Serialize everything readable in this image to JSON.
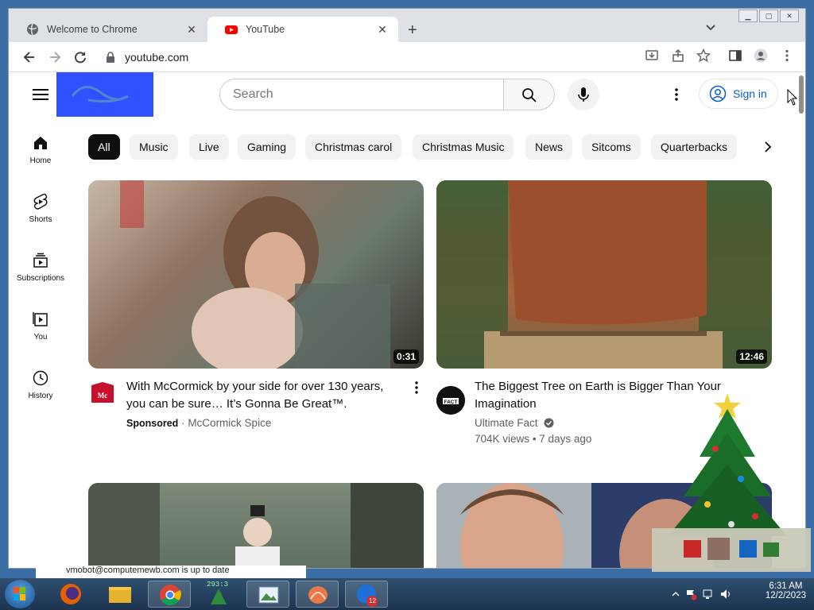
{
  "browser": {
    "tabs": [
      {
        "title": "Welcome to Chrome",
        "active": false
      },
      {
        "title": "YouTube",
        "active": true
      }
    ],
    "url": "youtube.com"
  },
  "youtube": {
    "search_placeholder": "Search",
    "sign_in": "Sign in",
    "sidebar": [
      {
        "label": "Home",
        "icon": "home-icon"
      },
      {
        "label": "Shorts",
        "icon": "shorts-icon"
      },
      {
        "label": "Subscriptions",
        "icon": "subscriptions-icon"
      },
      {
        "label": "You",
        "icon": "you-icon"
      },
      {
        "label": "History",
        "icon": "history-icon"
      }
    ],
    "chips": [
      "All",
      "Music",
      "Live",
      "Gaming",
      "Christmas carol",
      "Christmas Music",
      "News",
      "Sitcoms",
      "Quarterbacks"
    ],
    "videos": [
      {
        "title_line1": "With McCormick by your side for over 130 years,",
        "title_line2": "you can be sure… It’s Gonna Be Great™.",
        "sponsored": "Sponsored",
        "channel": "McCormick Spice",
        "duration": "0:31"
      },
      {
        "title_line1": "The Biggest Tree on Earth is Bigger Than Your",
        "title_line2": "Imagination",
        "channel": "Ultimate Fact",
        "views": "704K views",
        "age": "7 days ago",
        "duration": "12:46"
      }
    ]
  },
  "taskbar": {
    "notification": "vmobot@computemewb.com is up to date",
    "time": "6:31 AM",
    "date": "12/2/2023",
    "badge": "12",
    "gadget_text": "293:3"
  },
  "colors": {
    "chrome_tabstrip": "#dee1e6",
    "yt_link_blue": "#065fd4",
    "taskbar": "#1c3450"
  }
}
